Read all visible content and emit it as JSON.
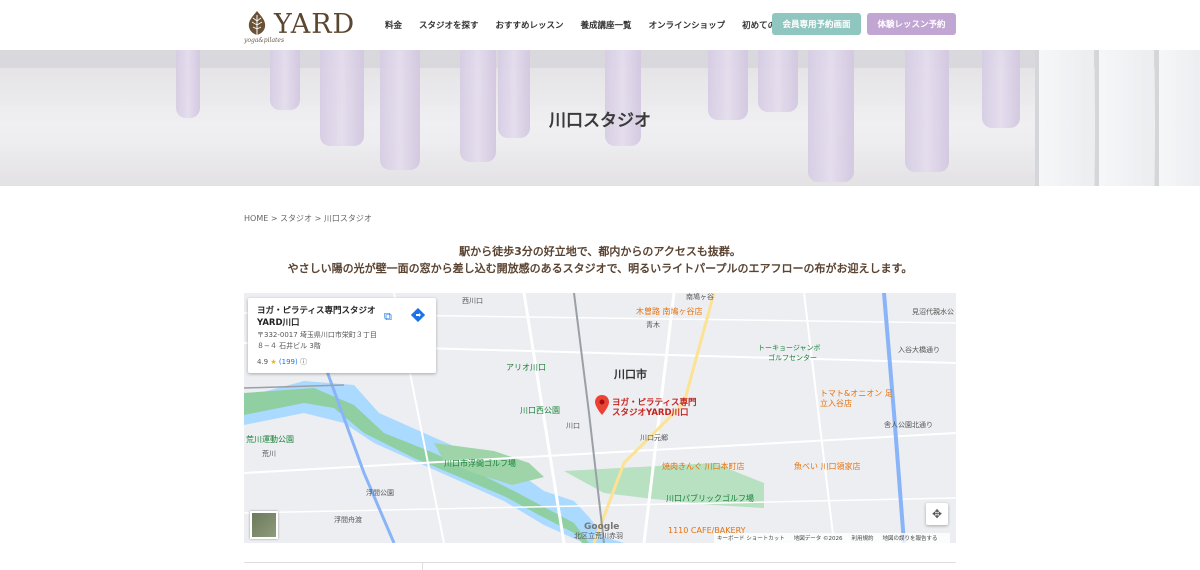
{
  "header": {
    "logo_text": "YARD",
    "logo_sub": "yoga&pilates",
    "nav": [
      "料金",
      "スタジオを探す",
      "おすすめレッスン",
      "養成講座一覧",
      "オンラインショップ",
      "初めての方へ"
    ],
    "member_button": "会員専用予約画面",
    "trial_button": "体験レッスン予約",
    "colors": {
      "member": "#8fc7c0",
      "trial": "#c1a5d3",
      "brand": "#5b4630"
    }
  },
  "hero": {
    "title": "川口スタジオ"
  },
  "breadcrumb": "HOME > スタジオ > 川口スタジオ",
  "intro": {
    "line1": "駅から徒歩3分の好立地で、都内からのアクセスも抜群。",
    "line2": "やさしい陽の光が壁一面の窓から差し込む開放感のあるスタジオで、明るいライトパープルのエアフローの布がお迎えします。"
  },
  "map": {
    "place_name": "ヨガ・ピラティス専門スタジオYARD川口",
    "address": "〒332-0017 埼玉県川口市栄町３丁目８−４ 石井ビル 3階",
    "rating": "4.9",
    "reviews": "(199)",
    "pin_label_1": "ヨガ・ピラティス専門",
    "pin_label_2": "スタジオYARD川口",
    "city": "川口市",
    "labels": [
      "西川口",
      "南鳩ヶ谷",
      "青木",
      "見沼代親水公",
      "入谷大橋通り",
      "アリオ川口",
      "トーキョージャンボ",
      "ゴルフセンター",
      "川口西公園",
      "川口",
      "川口元郷",
      "荒川運動公園",
      "荒川",
      "浮間公園",
      "浮間舟渡",
      "北区立荒川赤羽",
      "舎人公園北通り"
    ],
    "poi_orange": [
      "木曽路 南鳩ヶ谷店",
      "焼肉きんぐ 川口本町店",
      "魚べい 川口領家店",
      "トマト&オニオン 足立入谷店",
      "1110 CAFE/BAKERY"
    ],
    "poi_green": [
      "川口市浮間ゴルフ場",
      "川口パブリックゴルフ場"
    ],
    "google": "Google",
    "terms": [
      "キーボード ショートカット",
      "地図データ ©2026",
      "利用規約",
      "地図の誤りを報告する"
    ]
  }
}
